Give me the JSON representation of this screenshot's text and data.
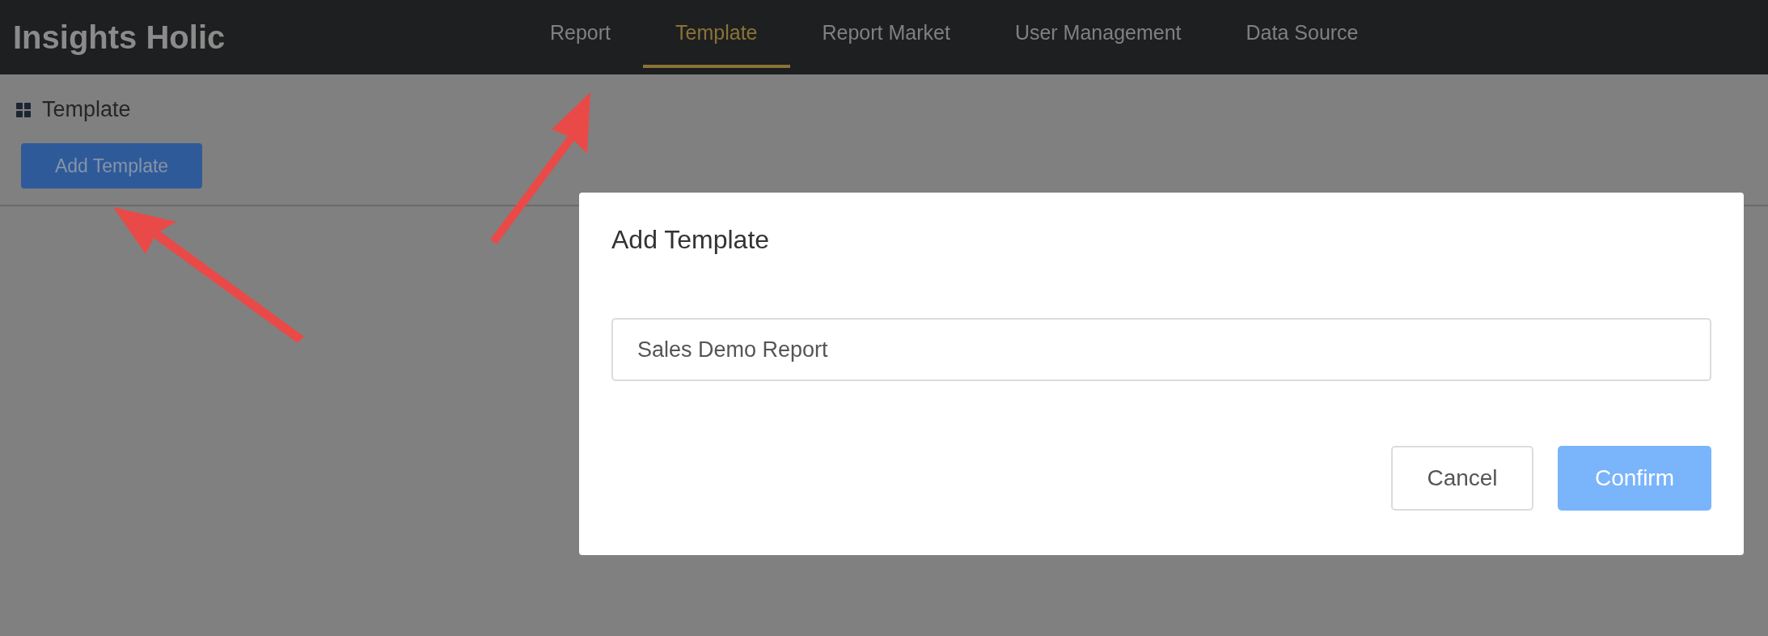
{
  "app": {
    "title": "Insights Holic"
  },
  "nav": [
    {
      "label": "Report",
      "selected": false
    },
    {
      "label": "Template",
      "selected": true
    },
    {
      "label": "Report Market",
      "selected": false
    },
    {
      "label": "User Management",
      "selected": false
    },
    {
      "label": "Data Source",
      "selected": false
    }
  ],
  "page": {
    "heading": "Template",
    "add_button": "Add Template"
  },
  "dialog": {
    "title": "Add Template",
    "name_field": {
      "value": "Sales Demo Report"
    },
    "buttons": [
      {
        "label": "Cancel",
        "kind": "secondary"
      },
      {
        "label": "Confirm",
        "kind": "primary"
      }
    ]
  }
}
